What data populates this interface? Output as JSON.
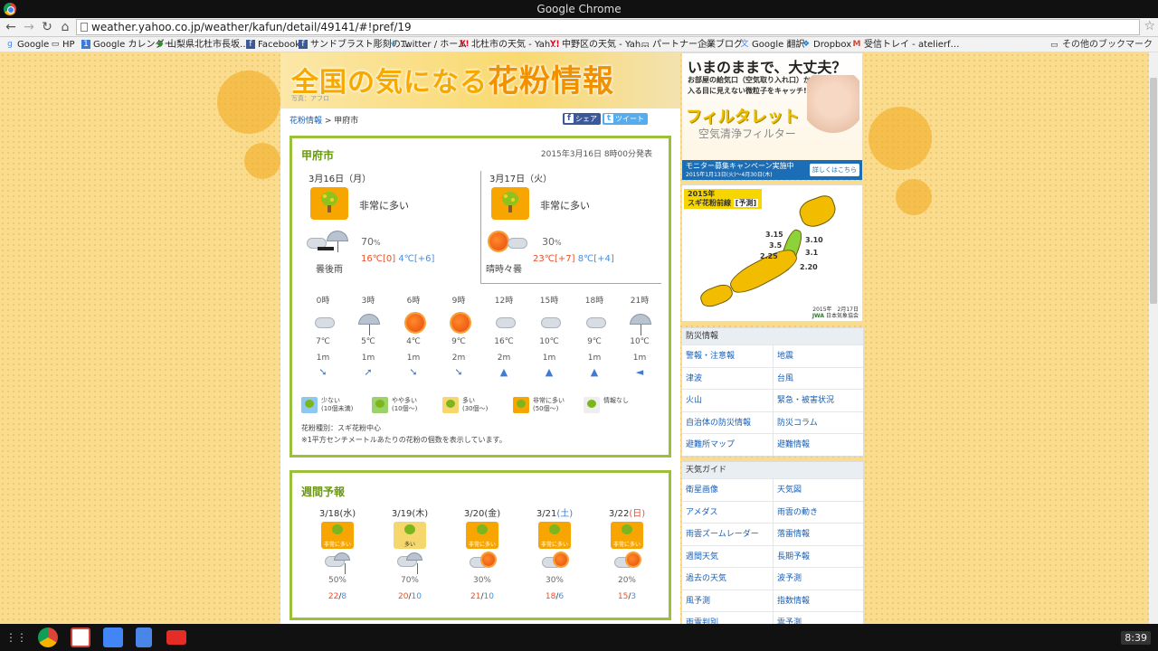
{
  "browser": {
    "window_title": "Google Chrome",
    "url": "weather.yahoo.co.jp/weather/kafun/detail/49141/#!pref/19",
    "bookmarks": [
      {
        "label": "Google",
        "icon": "google-icon"
      },
      {
        "label": "HP",
        "icon": "folder-icon"
      },
      {
        "label": "Google カレンダー",
        "icon": "calendar-icon"
      },
      {
        "label": "山梨県北杜市長坂…",
        "icon": "map-icon"
      },
      {
        "label": "Facebook",
        "icon": "facebook-icon"
      },
      {
        "label": "サンドブラスト彫刻の…",
        "icon": "facebook-icon"
      },
      {
        "label": "Twitter / ホーム",
        "icon": "twitter-icon"
      },
      {
        "label": "北杜市の天気 - Yah…",
        "icon": "yahoo-icon"
      },
      {
        "label": "中野区の天気 - Yah…",
        "icon": "yahoo-icon"
      },
      {
        "label": "パートナー企業",
        "icon": "folder-icon"
      },
      {
        "label": "ブログ",
        "icon": "folder-icon"
      },
      {
        "label": "Google 翻訳",
        "icon": "translate-icon"
      },
      {
        "label": "Dropbox",
        "icon": "dropbox-icon"
      },
      {
        "label": "受信トレイ - atelierf…",
        "icon": "gmail-icon"
      }
    ],
    "other_bookmarks": "その他のブックマーク"
  },
  "page": {
    "banner_title_a": "全国の気になる",
    "banner_title_b": "花粉情報",
    "banner_credit": "写真：アフロ",
    "breadcrumb_link": "花粉情報",
    "breadcrumb_sep": " > ",
    "breadcrumb_current": "甲府市",
    "share_label": "シェア",
    "tweet_label": "ツイート"
  },
  "today_panel": {
    "city": "甲府市",
    "published": "2015年3月16日 8時00分発表",
    "days": [
      {
        "date": "3月16日（月）",
        "pollen": "非常に多い",
        "precip": "70",
        "precip_unit": "%",
        "desc": "曇後雨",
        "hi": "16℃[0]",
        "lo": "4℃[+6]",
        "icon": "cloud-rain-icon"
      },
      {
        "date": "3月17日（火）",
        "pollen": "非常に多い",
        "precip": "30",
        "precip_unit": "%",
        "desc": "晴時々曇",
        "hi": "23℃[+7]",
        "lo": "8℃[+4]",
        "icon": "sun-cloud-icon"
      }
    ],
    "hourly": [
      {
        "hour": "0時",
        "temp": "7℃",
        "wind": "1m",
        "arrow": "➘",
        "icon": "cloud"
      },
      {
        "hour": "3時",
        "temp": "5℃",
        "wind": "1m",
        "arrow": "➚",
        "icon": "umbrella"
      },
      {
        "hour": "6時",
        "temp": "4℃",
        "wind": "1m",
        "arrow": "➘",
        "icon": "sun"
      },
      {
        "hour": "9時",
        "temp": "9℃",
        "wind": "2m",
        "arrow": "➘",
        "icon": "sun"
      },
      {
        "hour": "12時",
        "temp": "16℃",
        "wind": "2m",
        "arrow": "▲",
        "icon": "cloud"
      },
      {
        "hour": "15時",
        "temp": "10℃",
        "wind": "1m",
        "arrow": "▲",
        "icon": "cloud"
      },
      {
        "hour": "18時",
        "temp": "9℃",
        "wind": "1m",
        "arrow": "▲",
        "icon": "cloud"
      },
      {
        "hour": "21時",
        "temp": "10℃",
        "wind": "1m",
        "arrow": "◄",
        "icon": "umbrella"
      }
    ],
    "legend": [
      {
        "line1": "少ない",
        "line2": "(10個未満)",
        "color": "#8ec7ef"
      },
      {
        "line1": "やや多い",
        "line2": "(10個〜)",
        "color": "#9bd36a"
      },
      {
        "line1": "多い",
        "line2": "(30個〜)",
        "color": "#f5d76e"
      },
      {
        "line1": "非常に多い",
        "line2": "(50個〜)",
        "color": "#f7a500"
      },
      {
        "line1": "情報なし",
        "line2": "",
        "color": "#eeeeee"
      }
    ],
    "note1": "花粉種別：スギ花粉中心",
    "note2": "※1平方センチメートルあたりの花粉の個数を表示しています。"
  },
  "weekly_panel": {
    "title": "週間予報",
    "days": [
      {
        "date": "3/18",
        "dow": "(水)",
        "level": "非常に多い",
        "color": "#f7a500",
        "pct": "50%",
        "hi": "22",
        "lo": "8",
        "icon": "cloud-rain"
      },
      {
        "date": "3/19",
        "dow": "(木)",
        "level": "多い",
        "color": "#f5d76e",
        "pct": "70%",
        "hi": "20",
        "lo": "10",
        "icon": "cloud-rain"
      },
      {
        "date": "3/20",
        "dow": "(金)",
        "level": "非常に多い",
        "color": "#f7a500",
        "pct": "30%",
        "hi": "21",
        "lo": "10",
        "icon": "cloud-sun"
      },
      {
        "date": "3/21",
        "dow": "(土)",
        "level": "非常に多い",
        "color": "#f7a500",
        "pct": "30%",
        "hi": "18",
        "lo": "6",
        "icon": "cloud-sun"
      },
      {
        "date": "3/22",
        "dow": "(日)",
        "level": "非常に多い",
        "color": "#f7a500",
        "pct": "20%",
        "hi": "15",
        "lo": "3",
        "icon": "cloud-sun"
      }
    ]
  },
  "ad": {
    "headline": "いまのままで、大丈夫？",
    "sub1": "お部屋の給気口（空気取り入れ口）から",
    "sub2": "入る目に見えない微粒子をキャッチ!",
    "brand": "フィルタレット",
    "product": "空気清浄フィルター",
    "campaign": "モニター募集キャンペーン実施中",
    "campaign_dates": "2015年1月13日(火)〜4月30日(木)",
    "cta": "詳しくはこちら"
  },
  "map": {
    "label1": "2015年",
    "label2": "スギ花粉前線",
    "label3": "[予測]",
    "contours": [
      "3.15",
      "3.10",
      "3.5",
      "3.1",
      "2.25",
      "2.20"
    ],
    "date": "2015年　2月17日",
    "source": "日本気象協会",
    "logo": "JWA"
  },
  "disaster": {
    "title": "防災情報",
    "rows": [
      [
        "警報・注意報",
        "地震"
      ],
      [
        "津波",
        "台風"
      ],
      [
        "火山",
        "緊急・被害状況"
      ],
      [
        "自治体の防災情報",
        "防災コラム"
      ],
      [
        "避難所マップ",
        "避難情報"
      ]
    ]
  },
  "guide": {
    "title": "天気ガイド",
    "rows": [
      [
        "衛星画像",
        "天気図"
      ],
      [
        "アメダス",
        "雨雲の動き"
      ],
      [
        "雨雲ズームレーダー",
        "落雷情報"
      ],
      [
        "週間天気",
        "長期予報"
      ],
      [
        "過去の天気",
        "波予測"
      ],
      [
        "風予測",
        "指数情報"
      ],
      [
        "雨雪判別",
        "雲予測"
      ]
    ]
  },
  "taskbar": {
    "clock": "8:39"
  }
}
